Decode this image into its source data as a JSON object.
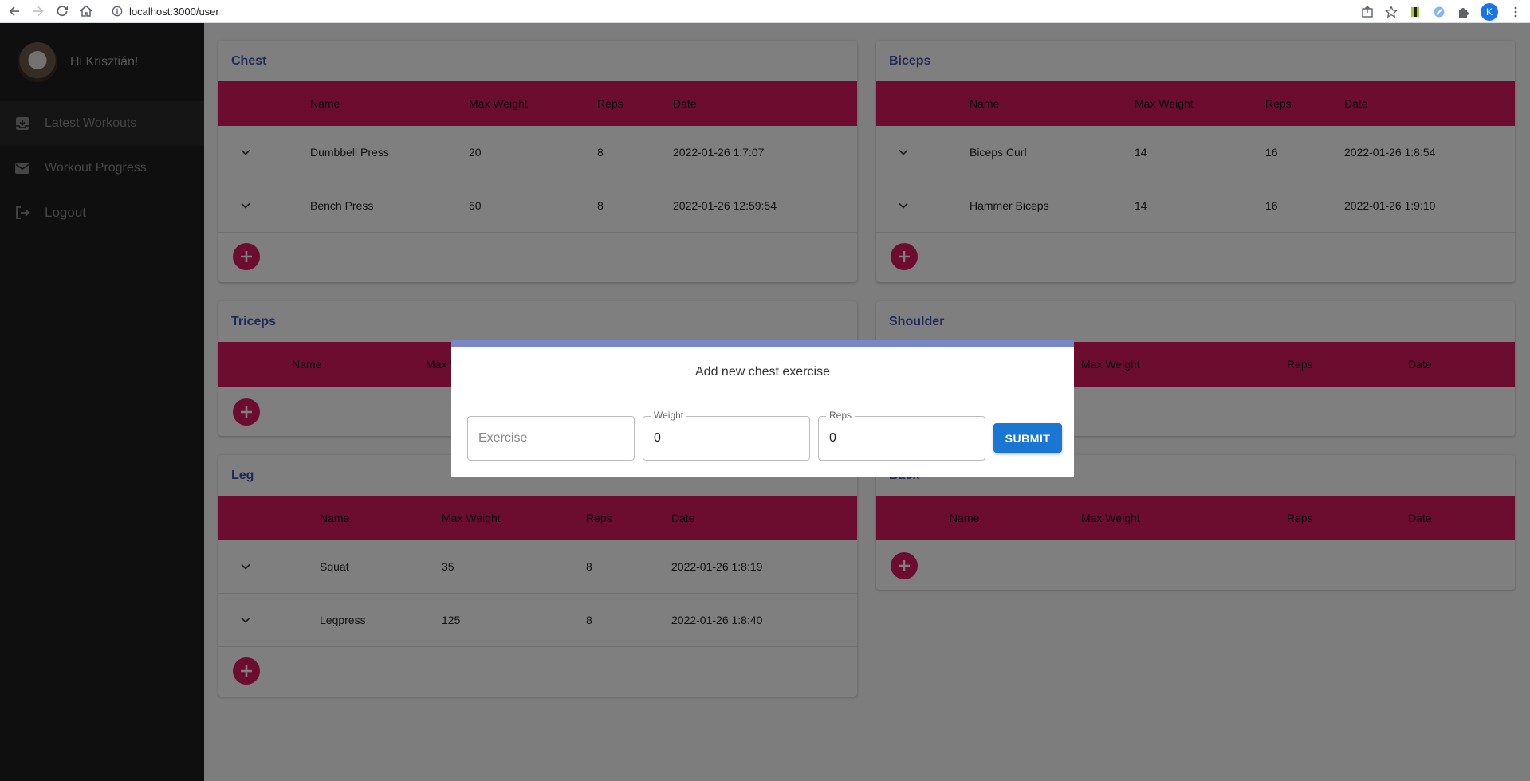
{
  "browser": {
    "url": "localhost:3000/user",
    "profile_initial": "K"
  },
  "sidebar": {
    "greeting": "Hi Krisztián!",
    "items": [
      {
        "label": "Latest Workouts",
        "icon": "inbox-download-icon"
      },
      {
        "label": "Workout Progress",
        "icon": "mail-icon"
      },
      {
        "label": "Logout",
        "icon": "logout-icon"
      }
    ]
  },
  "columns": {
    "name": "Name",
    "max_weight": "Max Weight",
    "reps": "Reps",
    "date": "Date"
  },
  "cards": {
    "chest": {
      "title": "Chest",
      "rows": [
        {
          "name": "Dumbbell Press",
          "max_weight": "20",
          "reps": "8",
          "date": "2022-01-26 1:7:07"
        },
        {
          "name": "Bench Press",
          "max_weight": "50",
          "reps": "8",
          "date": "2022-01-26 12:59:54"
        }
      ]
    },
    "biceps": {
      "title": "Biceps",
      "rows": [
        {
          "name": "Biceps Curl",
          "max_weight": "14",
          "reps": "16",
          "date": "2022-01-26 1:8:54"
        },
        {
          "name": "Hammer Biceps",
          "max_weight": "14",
          "reps": "16",
          "date": "2022-01-26 1:9:10"
        }
      ]
    },
    "triceps": {
      "title": "Triceps",
      "rows": []
    },
    "shoulder": {
      "title": "Shoulder",
      "rows": []
    },
    "leg": {
      "title": "Leg",
      "rows": [
        {
          "name": "Squat",
          "max_weight": "35",
          "reps": "8",
          "date": "2022-01-26 1:8:19"
        },
        {
          "name": "Legpress",
          "max_weight": "125",
          "reps": "8",
          "date": "2022-01-26 1:8:40"
        }
      ]
    },
    "back": {
      "title": "Back",
      "rows": []
    }
  },
  "modal": {
    "title": "Add new chest exercise",
    "exercise_placeholder": "Exercise",
    "weight_label": "Weight",
    "weight_value": "0",
    "reps_label": "Reps",
    "reps_value": "0",
    "submit_label": "SUBMIT"
  },
  "colors": {
    "accent_pink": "#d81b60",
    "title_blue": "#3f51b5",
    "modal_top_bar": "#7986cb",
    "submit_blue": "#1976d2"
  }
}
